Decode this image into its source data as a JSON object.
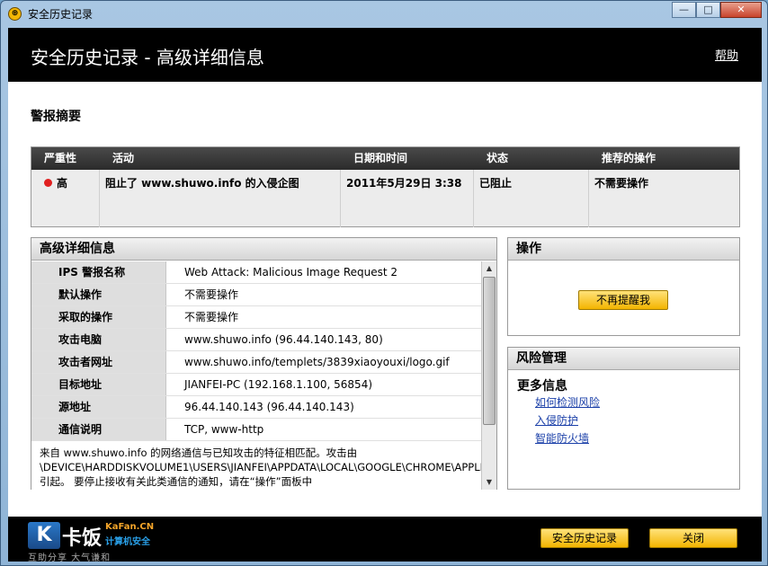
{
  "window": {
    "title": "安全历史记录",
    "btn_min": "—",
    "btn_max": "□",
    "btn_close": "✕"
  },
  "header": {
    "title": "安全历史记录 - 高级详细信息",
    "help": "帮助"
  },
  "summary": {
    "section_label": "警报摘要",
    "columns": [
      "严重性",
      "活动",
      "日期和时间",
      "状态",
      "推荐的操作"
    ],
    "row": {
      "severity": "高",
      "activity": "阻止了 www.shuwo.info 的入侵企图",
      "datetime": "2011年5月29日 3:38",
      "status": "已阻止",
      "recommended": "不需要操作"
    }
  },
  "details": {
    "title": "高级详细信息",
    "rows": [
      {
        "key": "IPS 警报名称",
        "value": "Web Attack: Malicious Image Request 2"
      },
      {
        "key": "默认操作",
        "value": "不需要操作"
      },
      {
        "key": "采取的操作",
        "value": "不需要操作"
      },
      {
        "key": "攻击电脑",
        "value": "www.shuwo.info (96.44.140.143, 80)"
      },
      {
        "key": "攻击者网址",
        "value": "www.shuwo.info/templets/3839xiaoyouxi/logo.gif"
      },
      {
        "key": "目标地址",
        "value": "JIANFEI-PC (192.168.1.100, 56854)"
      },
      {
        "key": "源地址",
        "value": "96.44.140.143 (96.44.140.143)"
      },
      {
        "key": "通信说明",
        "value": "TCP, www-http"
      }
    ],
    "description": "来自 www.shuwo.info 的网络通信与已知攻击的特征相匹配。攻击由 \\DEVICE\\HARDDISKVOLUME1\\USERS\\JIANFEI\\APPDATA\\LOCAL\\GOOGLE\\CHROME\\APPLICATION\\CHROME.EXE 引起。 要停止接收有关此类通信的通知，请在“操作”面板中"
  },
  "actions": {
    "title": "操作",
    "button": "不再提醒我"
  },
  "risk": {
    "title": "风险管理",
    "more_info": "更多信息",
    "links": [
      "如何检测风险",
      "入侵防护",
      "智能防火墙"
    ]
  },
  "footer": {
    "history_button": "安全历史记录",
    "close_button": "关闭",
    "logo": {
      "mark": "K",
      "name": "卡饭",
      "site": "KaFan.CN",
      "sub": "计算机安全",
      "tag": "互助分享  大气谦和"
    }
  },
  "colors": {
    "accent": "#f3b400",
    "link": "#1a3fa8",
    "severity_high": "#e02020"
  }
}
